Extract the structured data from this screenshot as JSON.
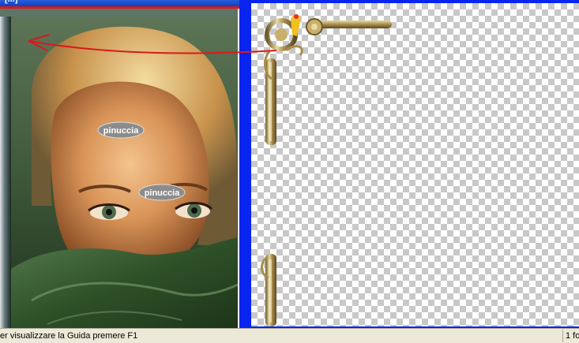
{
  "left_window": {
    "title": "[...]",
    "watermark_top": "pinuccia",
    "watermark_bottom": "pinuccia"
  },
  "status_bar": {
    "message": "er visualizzare la Guida premere F1",
    "pane_text": "1 fo"
  },
  "colors": {
    "workspace": "#0a24f0",
    "arrow": "#d91a1a",
    "frame_gold": "#c9b06a"
  }
}
